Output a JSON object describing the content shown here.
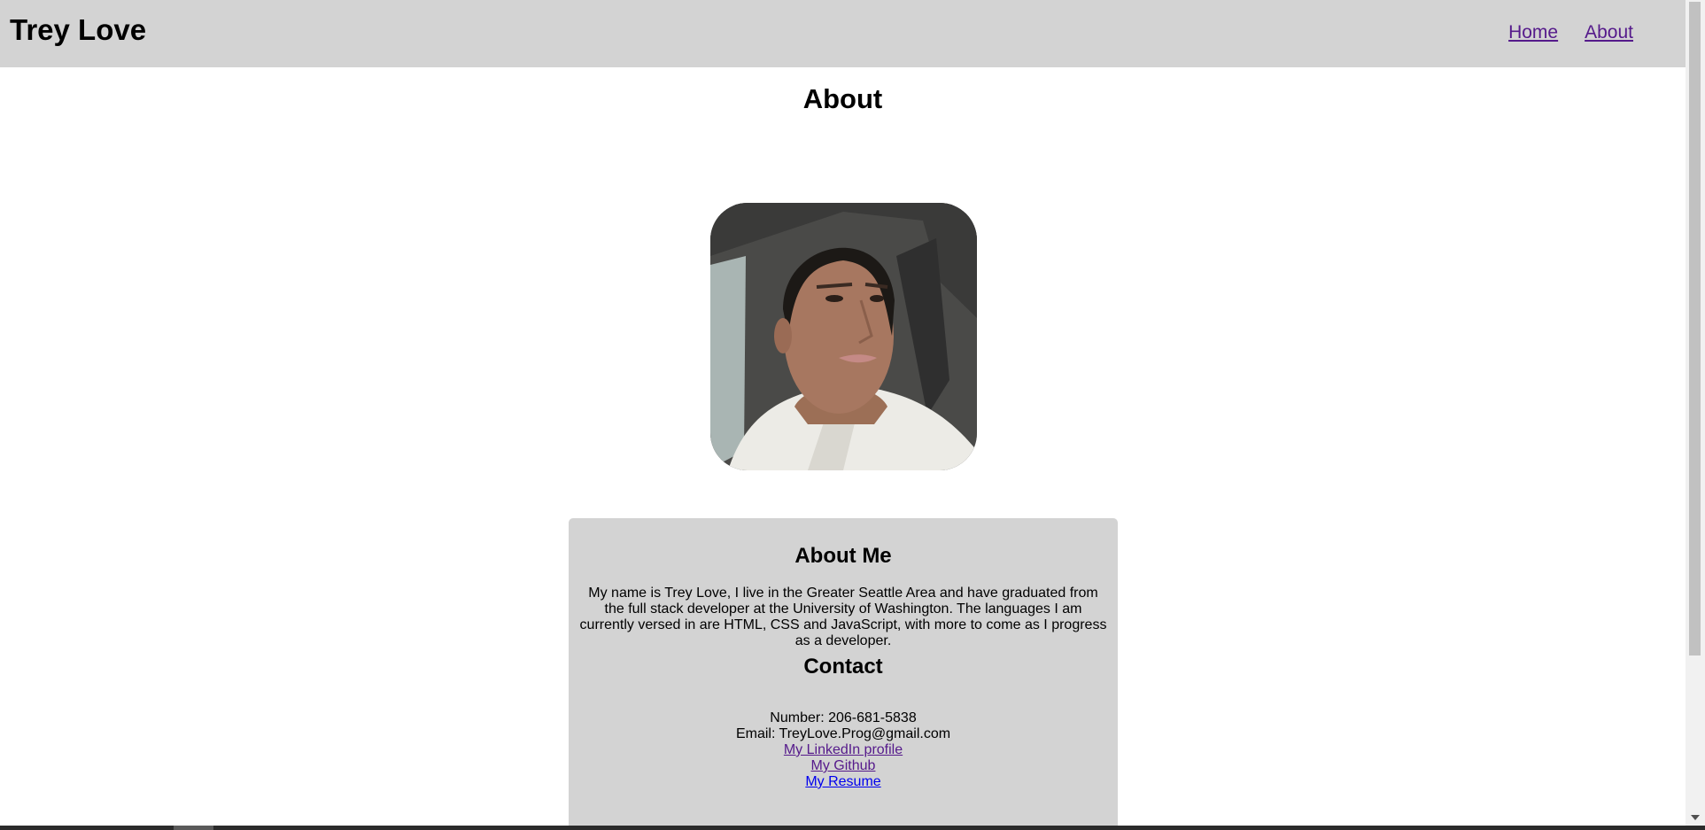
{
  "header": {
    "site_title": "Trey Love",
    "nav": [
      {
        "label": "Home"
      },
      {
        "label": "About"
      }
    ]
  },
  "main": {
    "page_title": "About",
    "portrait": {
      "icon": "profile-photo"
    },
    "about_card": {
      "about_heading": "About Me",
      "about_text": "My name is Trey Love, I live in the Greater Seattle Area and have graduated from the full stack developer at the University of Washington. The languages I am currently versed in are HTML, CSS and JavaScript, with more to come as I progress as a developer.",
      "contact_heading": "Contact",
      "number": "Number: 206-681-5838",
      "email": "Email: TreyLove.Prog@gmail.com",
      "links": {
        "linkedin": "My LinkedIn profile",
        "github": "My Github",
        "resume": "My Resume"
      }
    }
  },
  "colors": {
    "header_bg": "#d3d3d3",
    "card_bg": "#d3d3d3",
    "visited_link": "#551a8b",
    "link": "#0000ee"
  }
}
